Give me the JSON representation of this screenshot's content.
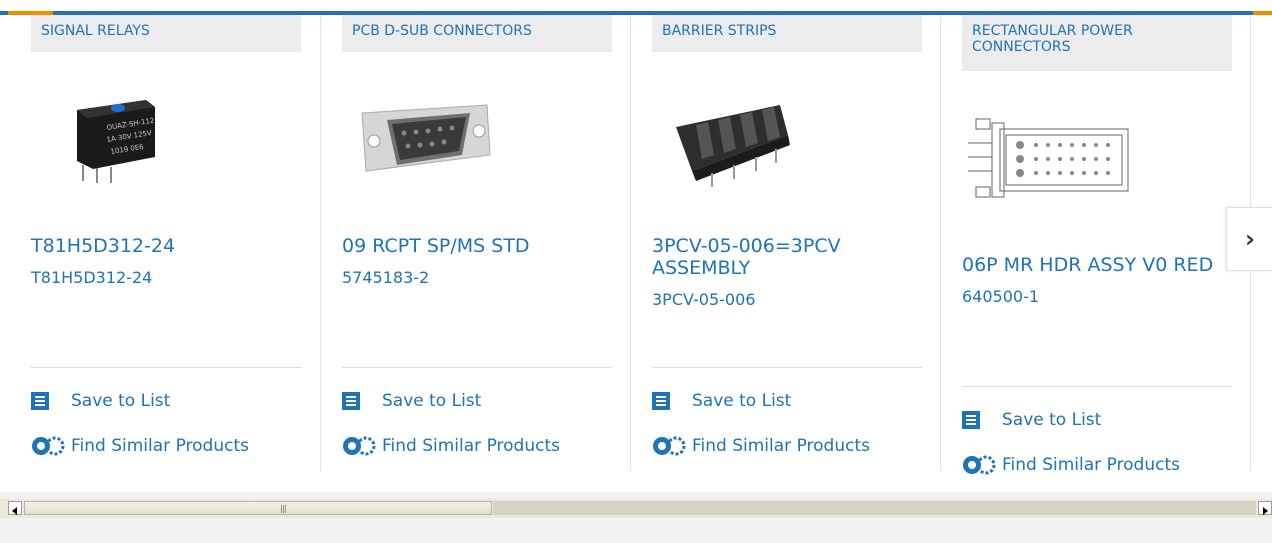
{
  "carousel": {
    "cards": [
      {
        "category": "SIGNAL RELAYS",
        "title": "T81H5D312-24",
        "part_number": "T81H5D312-24",
        "save_label": "Save to List",
        "similar_label": "Find Similar Products",
        "image_icon": "signal-relay-image"
      },
      {
        "category": "PCB D-SUB CONNECTORS",
        "title": "09 RCPT SP/MS STD",
        "part_number": "5745183-2",
        "save_label": "Save to List",
        "similar_label": "Find Similar Products",
        "image_icon": "dsub-connector-image"
      },
      {
        "category": "BARRIER STRIPS",
        "title": "3PCV-05-006=3PCV ASSEMBLY",
        "part_number": "3PCV-05-006",
        "save_label": "Save to List",
        "similar_label": "Find Similar Products",
        "image_icon": "barrier-strip-image"
      },
      {
        "category": "RECTANGULAR POWER CONNECTORS",
        "title": "06P MR HDR ASSY V0 RED",
        "part_number": "640500-1",
        "save_label": "Save to List",
        "similar_label": "Find Similar Products",
        "image_icon": "power-connector-image"
      }
    ],
    "next_arrow": "›"
  },
  "colors": {
    "accent": "#1f73b7",
    "highlight": "#f28d00"
  }
}
